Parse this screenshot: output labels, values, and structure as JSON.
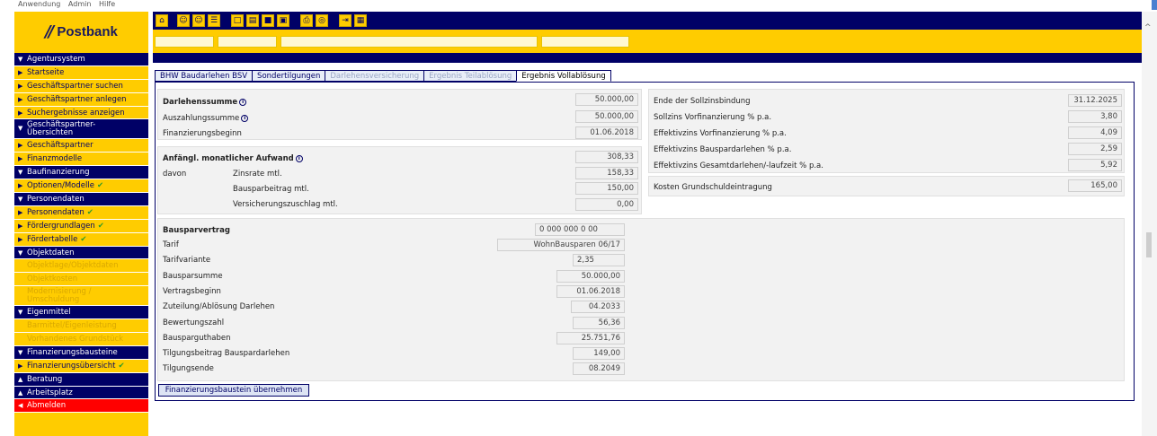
{
  "top_menu": [
    "Anwendung",
    "Admin",
    "Hilfe"
  ],
  "brand": {
    "logo_text": "Postbank",
    "color": "#000066",
    "accent": "#ffcc00",
    "error": "#ff0000"
  },
  "sidebar": [
    {
      "label": "Agentursystem",
      "type": "header",
      "icon": "chevron-down"
    },
    {
      "label": "Startseite",
      "type": "link",
      "icon": "chevron-right"
    },
    {
      "label": "Geschäftspartner suchen",
      "type": "link",
      "icon": "chevron-right"
    },
    {
      "label": "Geschäftspartner anlegen",
      "type": "link",
      "icon": "chevron-right"
    },
    {
      "label": "Suchergebnisse anzeigen",
      "type": "link",
      "icon": "chevron-right"
    },
    {
      "label": "Geschäftspartner-\nÜbersichten",
      "type": "header2",
      "icon": "chevron-down"
    },
    {
      "label": "Geschäftspartner",
      "type": "link",
      "icon": "chevron-right"
    },
    {
      "label": "Finanzmodelle",
      "type": "link",
      "icon": "chevron-right"
    },
    {
      "label": "Baufinanzierung",
      "type": "header",
      "icon": "chevron-down"
    },
    {
      "label": "Optionen/Modelle",
      "type": "link",
      "icon": "chevron-right",
      "check": true
    },
    {
      "label": "Personendaten",
      "type": "header",
      "icon": "chevron-down"
    },
    {
      "label": "Personendaten",
      "type": "link",
      "icon": "chevron-right",
      "check": true
    },
    {
      "label": "Fördergrundlagen",
      "type": "link",
      "icon": "chevron-right",
      "check": true
    },
    {
      "label": "Fördertabelle",
      "type": "link",
      "icon": "chevron-right",
      "check": true
    },
    {
      "label": "Objektdaten",
      "type": "header",
      "icon": "chevron-down"
    },
    {
      "label": "Objektlage/Objektdaten",
      "type": "disabled"
    },
    {
      "label": "Objektkosten",
      "type": "disabled"
    },
    {
      "label": "Modernisierung /\nUmschuldung",
      "type": "disabled2"
    },
    {
      "label": "Eigenmittel",
      "type": "header",
      "icon": "chevron-down"
    },
    {
      "label": "Barmittel/Eigenleistung",
      "type": "disabled"
    },
    {
      "label": "Vorhandenes Grundstück",
      "type": "disabled"
    },
    {
      "label": "Finanzierungsbausteine",
      "type": "header",
      "icon": "chevron-down"
    },
    {
      "label": "Finanzierungsübersicht",
      "type": "link",
      "icon": "chevron-right",
      "check": true
    },
    {
      "label": "Beratung",
      "type": "header",
      "icon": "chevron-up"
    },
    {
      "label": "Arbeitsplatz",
      "type": "header",
      "icon": "chevron-up"
    },
    {
      "label": "Abmelden",
      "type": "red",
      "icon": "chevron-left"
    }
  ],
  "toolbar": [
    "home",
    "user-add",
    "user-edit",
    "user-list",
    "new-document",
    "open-folder",
    "save",
    "save-as",
    "print",
    "preview",
    "exit",
    "calculator"
  ],
  "tabs": [
    {
      "label": "BHW Baudarlehen BSV",
      "state": "normal"
    },
    {
      "label": "Sondertilgungen",
      "state": "normal"
    },
    {
      "label": "Darlehensversicherung",
      "state": "disabled"
    },
    {
      "label": "Ergebnis Teilablösung",
      "state": "disabled"
    },
    {
      "label": "Ergebnis Vollablösung",
      "state": "active"
    }
  ],
  "left_top": {
    "darlehenssumme_label": "Darlehenssumme",
    "darlehenssumme": "50.000,00",
    "auszahlung_label": "Auszahlungssumme",
    "auszahlung": "50.000,00",
    "beginn_label": "Finanzierungsbeginn",
    "beginn": "01.06.2018"
  },
  "aufwand": {
    "title": "Anfängl. monatlicher Aufwand",
    "total": "308,33",
    "davon": "davon",
    "zinsrate_label": "Zinsrate mtl.",
    "zinsrate": "158,33",
    "bauspar_label": "Bausparbeitrag mtl.",
    "bauspar": "150,00",
    "vers_label": "Versicherungszuschlag mtl.",
    "vers": "0,00"
  },
  "right_top": [
    {
      "label": "Ende der Sollzinsbindung",
      "value": "31.12.2025"
    },
    {
      "label": "Sollzins Vorfinanzierung % p.a.",
      "value": "3,80"
    },
    {
      "label": "Effektivzins Vorfinanzierung % p.a.",
      "value": "4,09"
    },
    {
      "label": "Effektivzins Bauspardarlehen % p.a.",
      "value": "2,59"
    },
    {
      "label": "Effektivzins Gesamtdarlehen/-laufzeit % p.a.",
      "value": "5,92"
    }
  ],
  "grundschuld": {
    "label": "Kosten Grundschuldeintragung",
    "value": "165,00"
  },
  "bausparvertrag": {
    "title": "Bausparvertrag",
    "number": "0 000 000 0 00",
    "rows": [
      {
        "label": "Tarif",
        "value": "WohnBausparen 06/17"
      },
      {
        "label": "Tarifvariante",
        "value": "2,35"
      },
      {
        "label": "Bausparsumme",
        "value": "50.000,00"
      },
      {
        "label": "Vertragsbeginn",
        "value": "01.06.2018"
      },
      {
        "label": "Zuteilung/Ablösung Darlehen",
        "value": "04.2033"
      },
      {
        "label": "Bewertungszahl",
        "value": "56,36"
      },
      {
        "label": "Bausparguthaben",
        "value": "25.751,76"
      },
      {
        "label": "Tilgungsbeitrag Bauspardarlehen",
        "value": "149,00"
      },
      {
        "label": "Tilgungsende",
        "value": "08.2049"
      }
    ]
  },
  "apply_button": "Finanzierungsbaustein übernehmen"
}
